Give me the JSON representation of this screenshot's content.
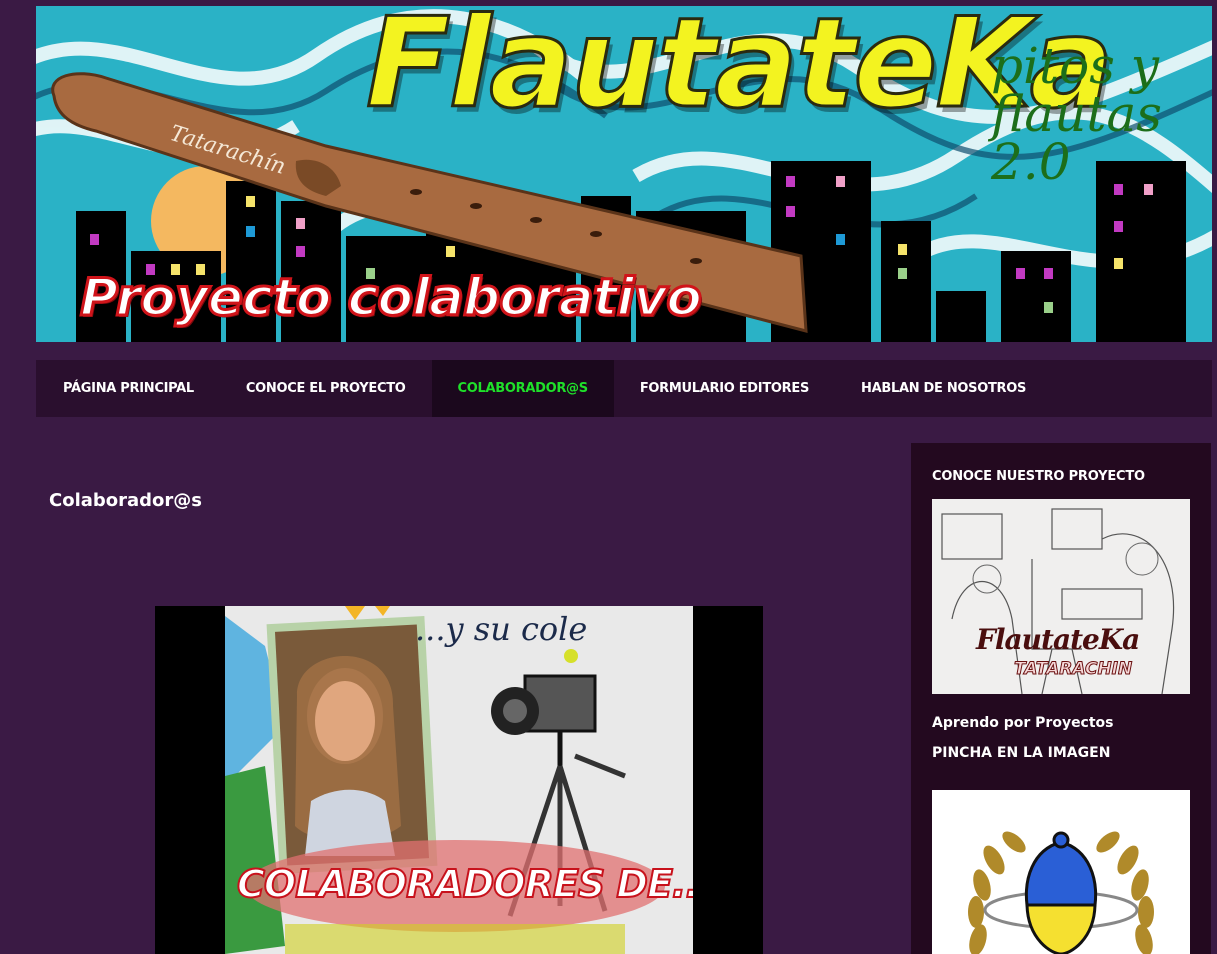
{
  "banner": {
    "title": "FlautateKa",
    "tagline": "pitos y flautas 2.0",
    "flute_label": "Tatarachín",
    "project": "Proyecto colaborativo"
  },
  "nav": {
    "items": [
      {
        "label": "PÁGINA PRINCIPAL",
        "active": false
      },
      {
        "label": "CONOCE EL PROYECTO",
        "active": false
      },
      {
        "label": "COLABORADOR@S",
        "active": true
      },
      {
        "label": "FORMULARIO EDITORES",
        "active": false
      },
      {
        "label": "HABLAN DE NOSOTROS",
        "active": false
      }
    ]
  },
  "post": {
    "title": "Colaborador@s",
    "image_caption": "COLABORADORES DE...",
    "image_script": "...y su cole"
  },
  "sidebar": {
    "widget_title": "CONOCE NUESTRO PROYECTO",
    "widget_image_title": "FlautateKa",
    "widget_image_sub": "TATARACHIN",
    "widget_text_line1": "Aprendo por Proyectos",
    "widget_text_line2": "PINCHA EN LA IMAGEN"
  },
  "colors": {
    "page_bg": "#3a1a44",
    "nav_bg": "#2a0f2e",
    "nav_active_text": "#1fe02a",
    "sidebar_bg": "#23091f",
    "banner_bg": "#2ab2c6",
    "title_yellow": "#f3f320"
  }
}
